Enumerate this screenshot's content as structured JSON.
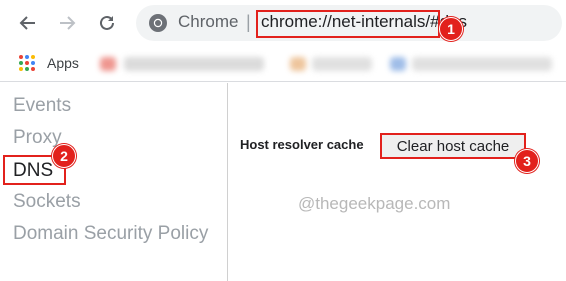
{
  "toolbar": {
    "omnibox_label": "Chrome",
    "separator": "|",
    "url": "chrome://net-internals/#dns"
  },
  "bookmarks": {
    "apps_label": "Apps"
  },
  "sidebar": {
    "items": [
      {
        "label": "Events"
      },
      {
        "label": "Proxy"
      },
      {
        "label": "DNS"
      },
      {
        "label": "Sockets"
      },
      {
        "label": "Domain Security Policy"
      }
    ]
  },
  "content": {
    "host_resolver_label": "Host resolver cache",
    "clear_button_label": "Clear host cache",
    "watermark": "@thegeekpage.com"
  },
  "annotations": {
    "step1": "1",
    "step2": "2",
    "step3": "3"
  },
  "colors": {
    "highlight": "#e2211c",
    "active_text": "#202124",
    "inactive_text": "#9aa0a6"
  }
}
